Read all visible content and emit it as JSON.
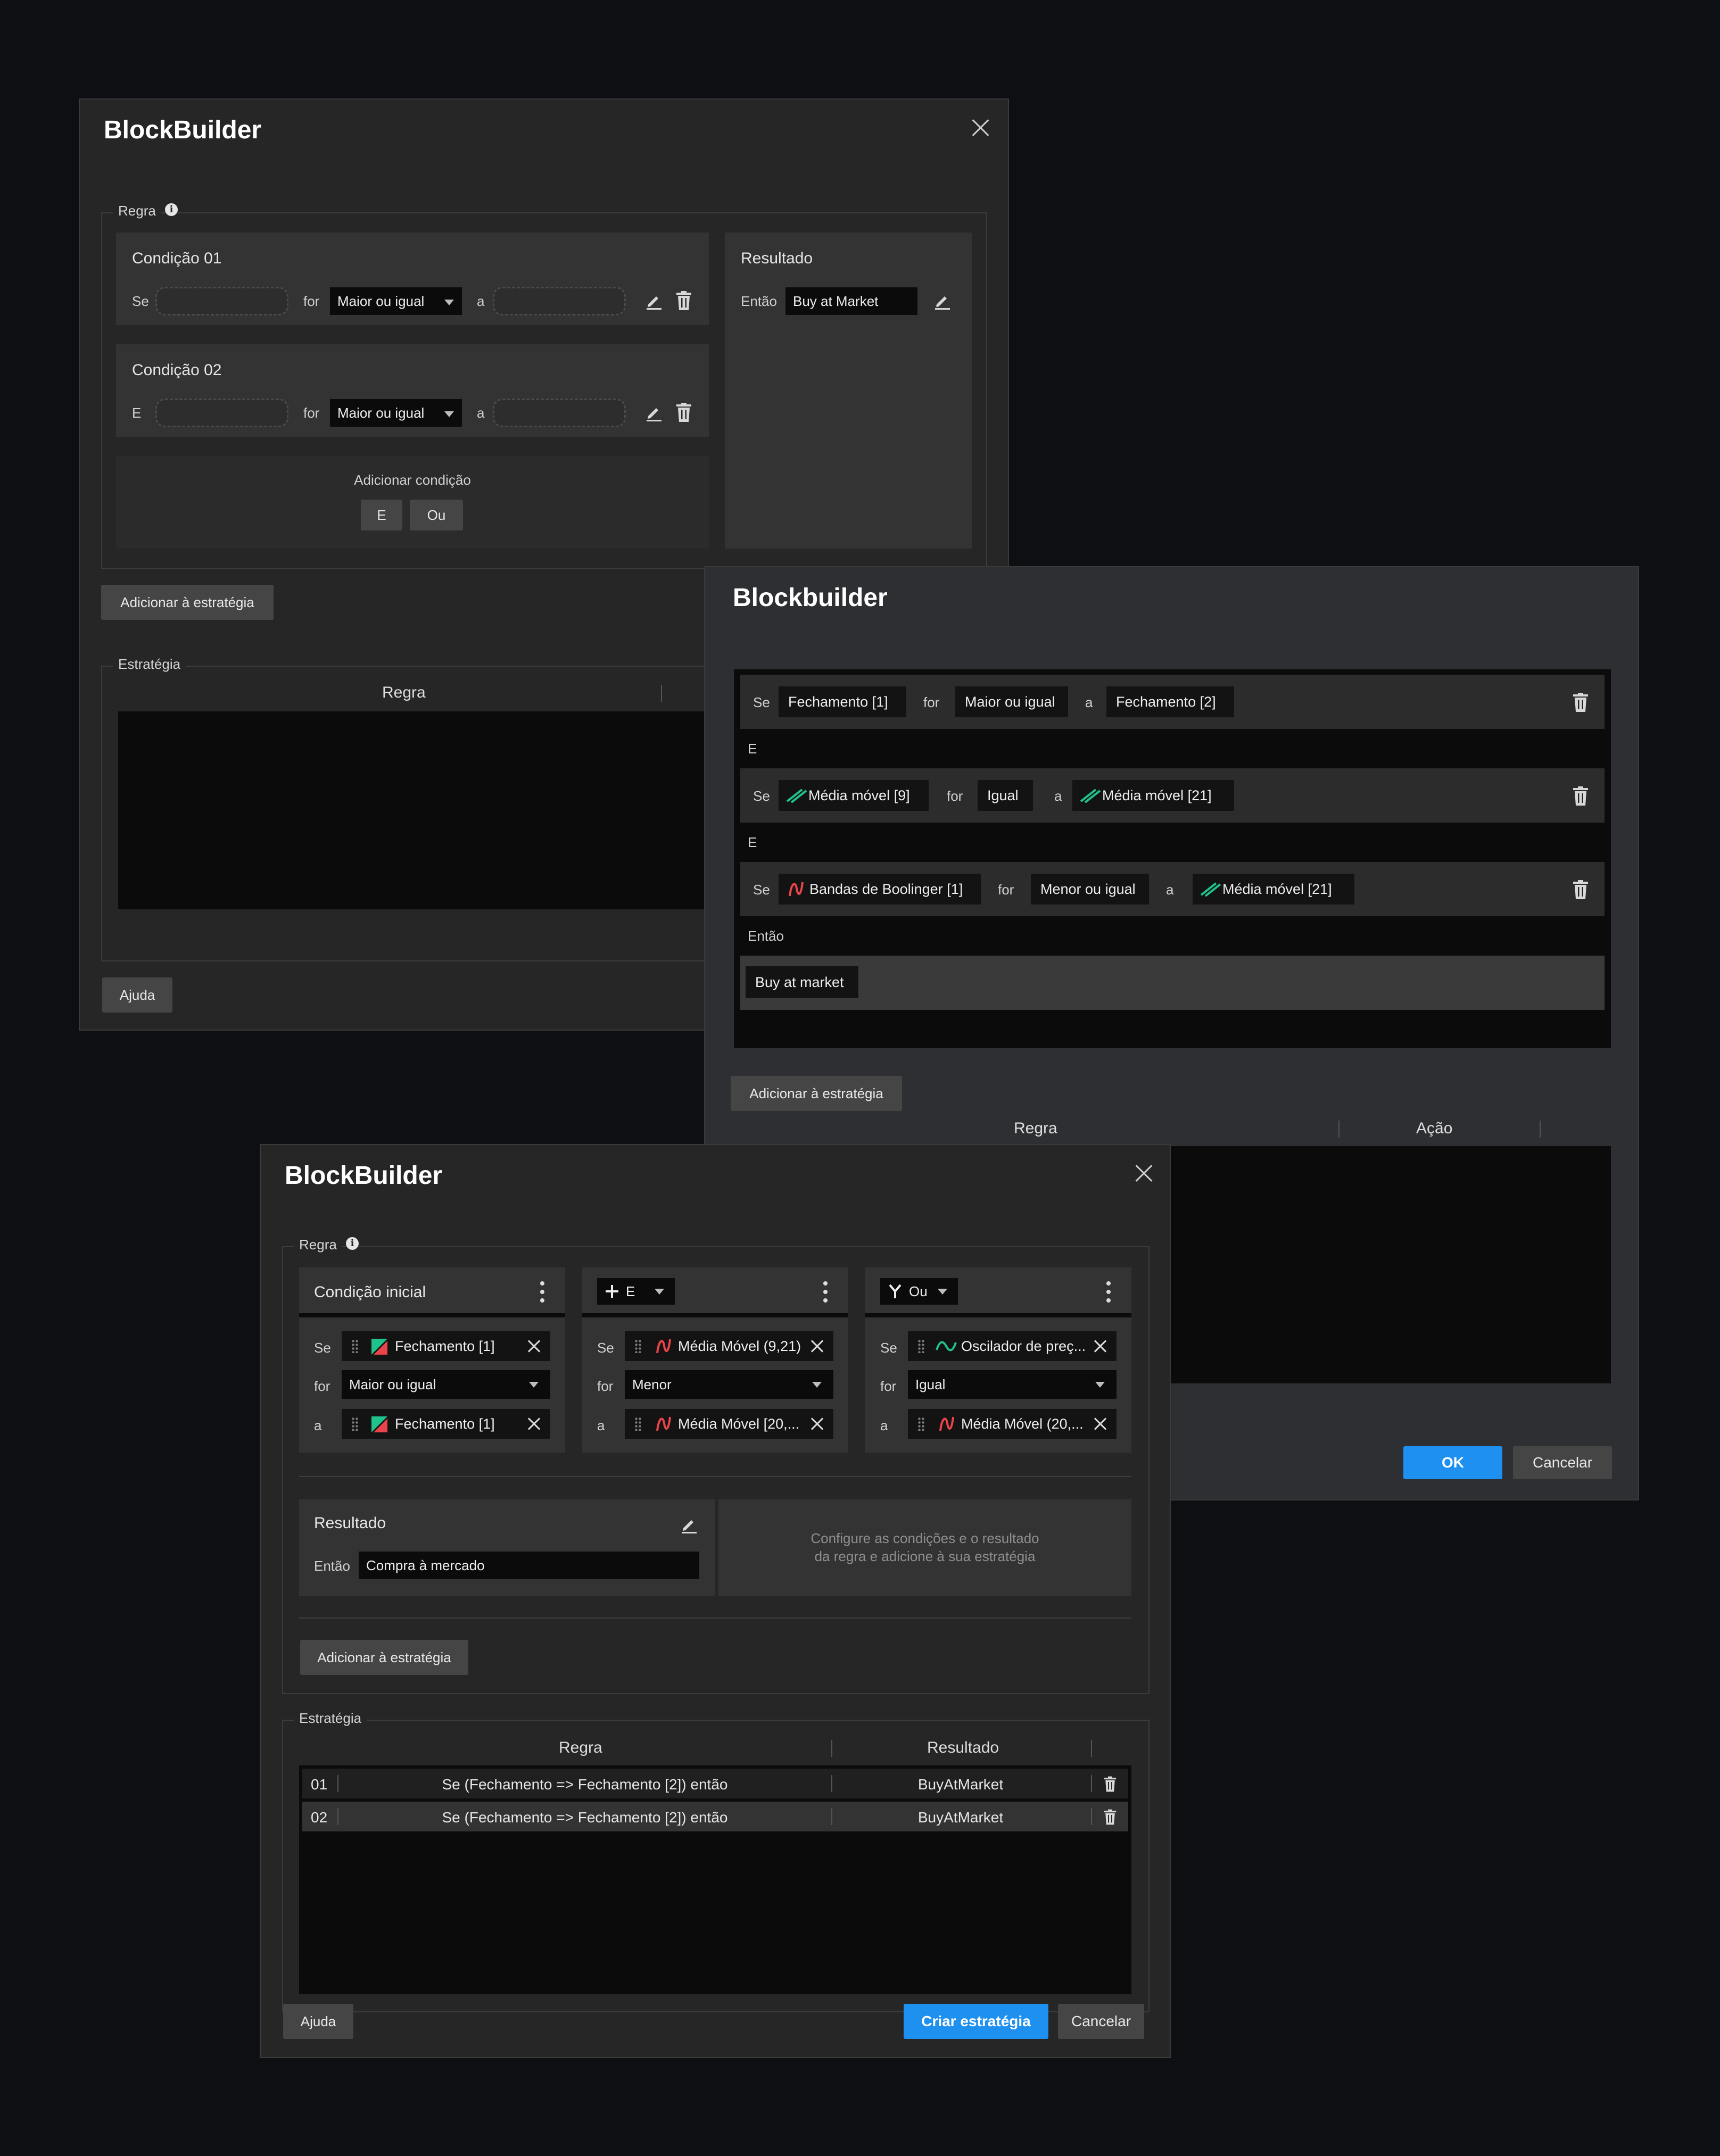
{
  "dialog1": {
    "title": "BlockBuilder",
    "regra_legend": "Regra",
    "cond1": {
      "title": "Condição 01",
      "prefix": "Se",
      "for": "for",
      "operator": "Maior ou igual",
      "a": "a"
    },
    "cond2": {
      "title": "Condição 02",
      "prefix": "E",
      "for": "for",
      "operator": "Maior ou igual",
      "a": "a"
    },
    "add_condition": {
      "label": "Adicionar condição",
      "and": "E",
      "or": "Ou"
    },
    "result": {
      "title": "Resultado",
      "then": "Então",
      "value": "Buy at Market"
    },
    "add_button": "Adicionar à estratégia",
    "strategy_legend": "Estratégia",
    "col_rule": "Regra",
    "help": "Ajuda"
  },
  "dialog2": {
    "title": "Blockbuilder",
    "rows": [
      {
        "se": "Se",
        "left": "Fechamento [1]",
        "for": "for",
        "op": "Maior ou igual",
        "a": "a",
        "right": "Fechamento [2]"
      },
      {
        "se": "Se",
        "left": "Média móvel [9]",
        "for": "for",
        "op": "Igual",
        "a": "a",
        "right": "Média móvel [21]"
      },
      {
        "se": "Se",
        "left": "Bandas de Boolinger [1]",
        "for": "for",
        "op": "Menor ou igual",
        "a": "a",
        "right": "Média móvel [21]"
      }
    ],
    "connector1": "E",
    "connector2": "E",
    "then": "Então",
    "action": "Buy at market",
    "add_button": "Adicionar à estratégia",
    "col_rule": "Regra",
    "col_action": "Ação",
    "ok": "OK",
    "cancel": "Cancelar"
  },
  "dialog3": {
    "title": "BlockBuilder",
    "regra_legend": "Regra",
    "blocks": [
      {
        "header": "Condição inicial",
        "se": "Se",
        "left": "Fechamento [1]",
        "for": "for",
        "op": "Maior ou igual",
        "a": "a",
        "right": "Fechamento [1]"
      },
      {
        "header": "E",
        "se": "Se",
        "left": "Média Móvel (9,21)",
        "for": "for",
        "op": "Menor",
        "a": "a",
        "right": "Média Móvel [20,..."
      },
      {
        "header": "Ou",
        "se": "Se",
        "left": "Oscilador de preç...",
        "for": "for",
        "op": "Igual",
        "a": "a",
        "right": "Média Móvel (20,..."
      }
    ],
    "result": {
      "title": "Resultado",
      "then": "Então",
      "value": "Compra à mercado"
    },
    "hint_line1": "Configure as condições e o resultado",
    "hint_line2": "da regra e adicione à sua estratégia",
    "add_button": "Adicionar à estratégia",
    "strategy_legend": "Estratégia",
    "col_rule": "Regra",
    "col_result": "Resultado",
    "table": [
      {
        "num": "01",
        "rule": "Se (Fechamento => Fechamento [2]) então",
        "result": "BuyAtMarket"
      },
      {
        "num": "02",
        "rule": "Se (Fechamento => Fechamento [2]) então",
        "result": "BuyAtMarket"
      }
    ],
    "help": "Ajuda",
    "create": "Criar estratégia",
    "cancel": "Cancelar"
  },
  "colors": {
    "accent": "#1e90ef",
    "green_icon": "#1fc28b",
    "red_icon": "#e8444a"
  }
}
